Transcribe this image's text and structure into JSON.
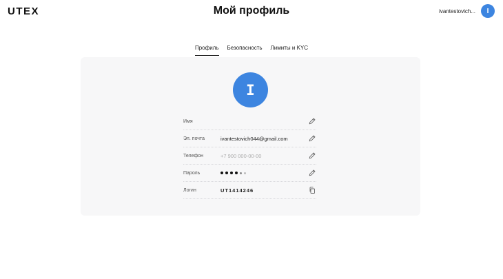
{
  "header": {
    "logo": "UTEX",
    "title": "Мой профиль",
    "user_name": "ivantestovich...",
    "avatar_letter": "I"
  },
  "tabs": [
    {
      "label": "Профиль",
      "active": true
    },
    {
      "label": "Безопасность",
      "active": false
    },
    {
      "label": "Лимиты и KYC",
      "active": false
    }
  ],
  "profile": {
    "avatar_letter": "I",
    "fields": [
      {
        "label": "Имя",
        "value": "",
        "action_icon": "pencil-icon"
      },
      {
        "label": "Эл. почта",
        "value": "ivantestovich044@gmail.com",
        "action_icon": "pencil-icon"
      },
      {
        "label": "Телефон",
        "value": "+7 900 000-00-00",
        "action_icon": "pencil-icon"
      },
      {
        "label": "Пароль",
        "value": "",
        "action_icon": "pencil-icon"
      },
      {
        "label": "Логин",
        "value": "UT1414246",
        "action_icon": "copy-icon"
      }
    ]
  },
  "colors": {
    "accent": "#3d85e0",
    "card_bg": "#f7f7f8"
  }
}
